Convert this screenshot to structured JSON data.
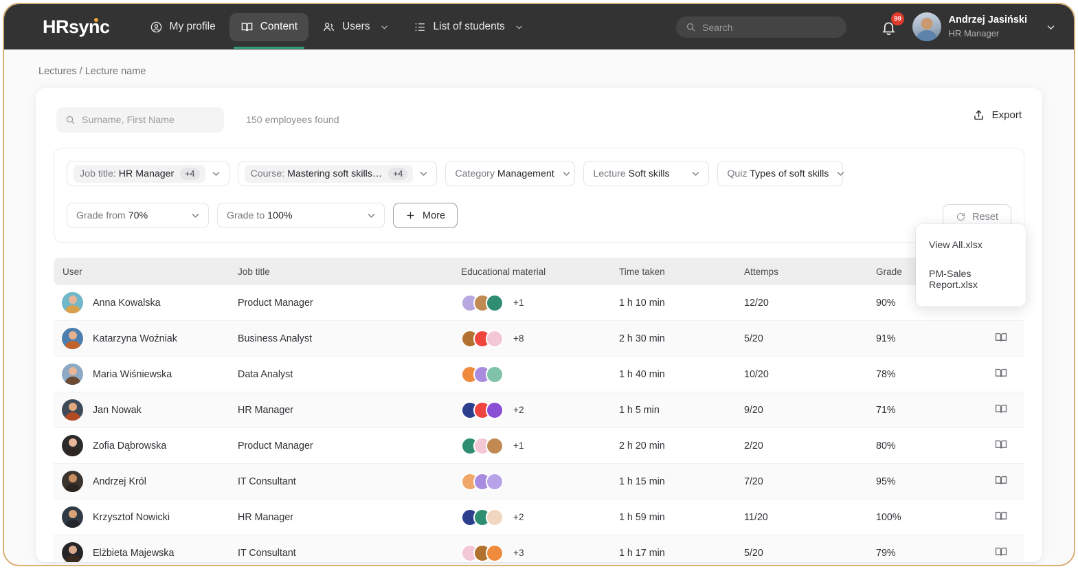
{
  "brand": {
    "name_prefix": "HR",
    "name_suffix": "sync"
  },
  "nav": [
    {
      "label": "My profile",
      "icon": "user-circle-icon",
      "active": false,
      "has_chevron": false
    },
    {
      "label": "Content",
      "icon": "book-icon",
      "active": true,
      "has_chevron": false
    },
    {
      "label": "Users",
      "icon": "users-icon",
      "active": false,
      "has_chevron": true
    },
    {
      "label": "List of students",
      "icon": "list-icon",
      "active": false,
      "has_chevron": true
    }
  ],
  "header": {
    "search_placeholder": "Search",
    "search_value": "",
    "notification_count": "99",
    "user_name": "Andrzej Jasiński",
    "user_role": "HR Manager"
  },
  "breadcrumb": "Lectures / Lecture name",
  "toolbar": {
    "search_placeholder": "Surname, First Name",
    "search_value": "",
    "results_text": "150 employees found",
    "export_label": "Export"
  },
  "export_menu": {
    "items": [
      "View All.xlsx",
      "PM-Sales Report.xlsx"
    ]
  },
  "filters": {
    "chips": [
      {
        "label": "Job title:",
        "value": "HR Manager",
        "count": "+4",
        "pill": true
      },
      {
        "label": "Course:",
        "value": "Mastering soft skills…",
        "count": "+4",
        "pill": true
      },
      {
        "label": "Category",
        "value": "Management",
        "count": "",
        "pill": false
      },
      {
        "label": "Lecture",
        "value": "Soft skills",
        "count": "",
        "pill": false
      },
      {
        "label": "Quiz",
        "value": "Types of soft skills",
        "count": "",
        "pill": false
      },
      {
        "label": "Grade from",
        "value": "70%",
        "count": "",
        "pill": false
      },
      {
        "label": "Grade to",
        "value": "100%",
        "count": "",
        "pill": false
      }
    ],
    "more_label": "More",
    "reset_label": "Reset"
  },
  "table": {
    "columns": [
      "User",
      "Job title",
      "Educational material",
      "Time taken",
      "Attemps",
      "Grade"
    ],
    "rows": [
      {
        "user": "Anna Kowalska",
        "job": "Product Manager",
        "materials": [
          "#b8a8e0",
          "#c08a52",
          "#2f8d72"
        ],
        "extra": "+1",
        "time": "1 h 10 min",
        "attempts": "12/20",
        "grade": "90%",
        "skin": "#e8b79a",
        "hair": "#d9a04e",
        "shirt": "#6fb7c9"
      },
      {
        "user": "Katarzyna Woźniak",
        "job": "Business Analyst",
        "materials": [
          "#b2722f",
          "#f0453f",
          "#f4c7d6"
        ],
        "extra": "+8",
        "time": "2 h 30 min",
        "attempts": "5/20",
        "grade": "91%",
        "skin": "#e6b091",
        "hair": "#c2622d",
        "shirt": "#4d7fae"
      },
      {
        "user": "Maria Wiśniewska",
        "job": "Data Analyst",
        "materials": [
          "#f08a3c",
          "#a98ce0",
          "#7fc3a8"
        ],
        "extra": "",
        "time": "1 h 40 min",
        "attempts": "10/20",
        "grade": "78%",
        "skin": "#e7b496",
        "hair": "#6b4a34",
        "shirt": "#8ea9c4"
      },
      {
        "user": "Jan Nowak",
        "job": "HR Manager",
        "materials": [
          "#2b3f8f",
          "#f0453f",
          "#8b4fd6"
        ],
        "extra": "+2",
        "time": "1 h 5 min",
        "attempts": "9/20",
        "grade": "71%",
        "skin": "#e2a87f",
        "hair": "#b24a24",
        "shirt": "#3f4a58"
      },
      {
        "user": "Zofia Dąbrowska",
        "job": "Product Manager",
        "materials": [
          "#2f8d72",
          "#f4c7d6",
          "#c08a52"
        ],
        "extra": "+1",
        "time": "2 h 20 min",
        "attempts": "2/20",
        "grade": "80%",
        "skin": "#e8b79a",
        "hair": "#2e2622",
        "shirt": "#2b2b2b"
      },
      {
        "user": "Andrzej Król",
        "job": "IT Consultant",
        "materials": [
          "#f0a86a",
          "#a98ce0",
          "#b9a3e8"
        ],
        "extra": "",
        "time": "1 h 15 min",
        "attempts": "7/20",
        "grade": "95%",
        "skin": "#c98e60",
        "hair": "#2a2320",
        "shirt": "#3a332e"
      },
      {
        "user": "Krzysztof Nowicki",
        "job": "HR Manager",
        "materials": [
          "#2b3f8f",
          "#2f8d72",
          "#f2d7c0"
        ],
        "extra": "+2",
        "time": "1 h 59 min",
        "attempts": "11/20",
        "grade": "100%",
        "skin": "#d9a277",
        "hair": "#24282e",
        "shirt": "#2f3a45"
      },
      {
        "user": "Elżbieta Majewska",
        "job": "IT Consultant",
        "materials": [
          "#f4c7d6",
          "#b2722f",
          "#f08a3c"
        ],
        "extra": "+3",
        "time": "1 h 17 min",
        "attempts": "5/20",
        "grade": "79%",
        "skin": "#d9a98c",
        "hair": "#3a2a20",
        "shirt": "#26262a"
      }
    ],
    "row_action_icon": "open-book-icon"
  },
  "colors": {
    "accent_green": "#2e9e78",
    "badge_red": "#e23b2e",
    "logo_dot_orange": "#f0a03a",
    "header_dark": "#333333",
    "frame_gold": "#d9b078"
  }
}
